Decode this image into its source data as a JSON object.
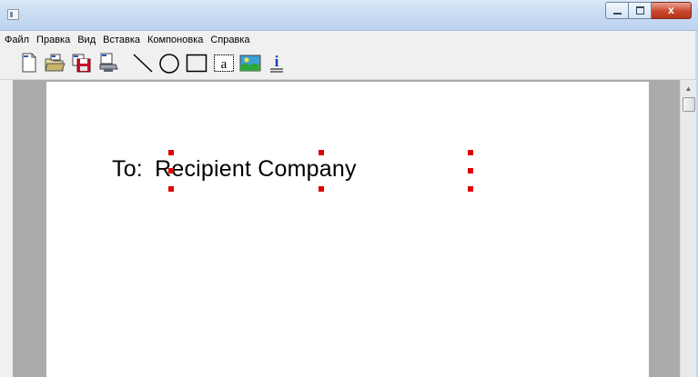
{
  "window": {
    "title": "",
    "close_glyph": "x"
  },
  "menu": {
    "items": [
      "Файл",
      "Правка",
      "Вид",
      "Вставка",
      "Компоновка",
      "Справка"
    ]
  },
  "toolbar": {
    "tools": [
      "new-document",
      "open-file",
      "save-file",
      "print",
      "line",
      "ellipse",
      "rectangle",
      "text",
      "image",
      "info"
    ],
    "text_tool_glyph": "a",
    "info_tool_glyph": "i"
  },
  "document": {
    "label_text": "To:",
    "field_text": "Recipient Company"
  },
  "colors": {
    "handle": "#e00000",
    "page": "#ffffff",
    "workspace": "#ababab"
  }
}
